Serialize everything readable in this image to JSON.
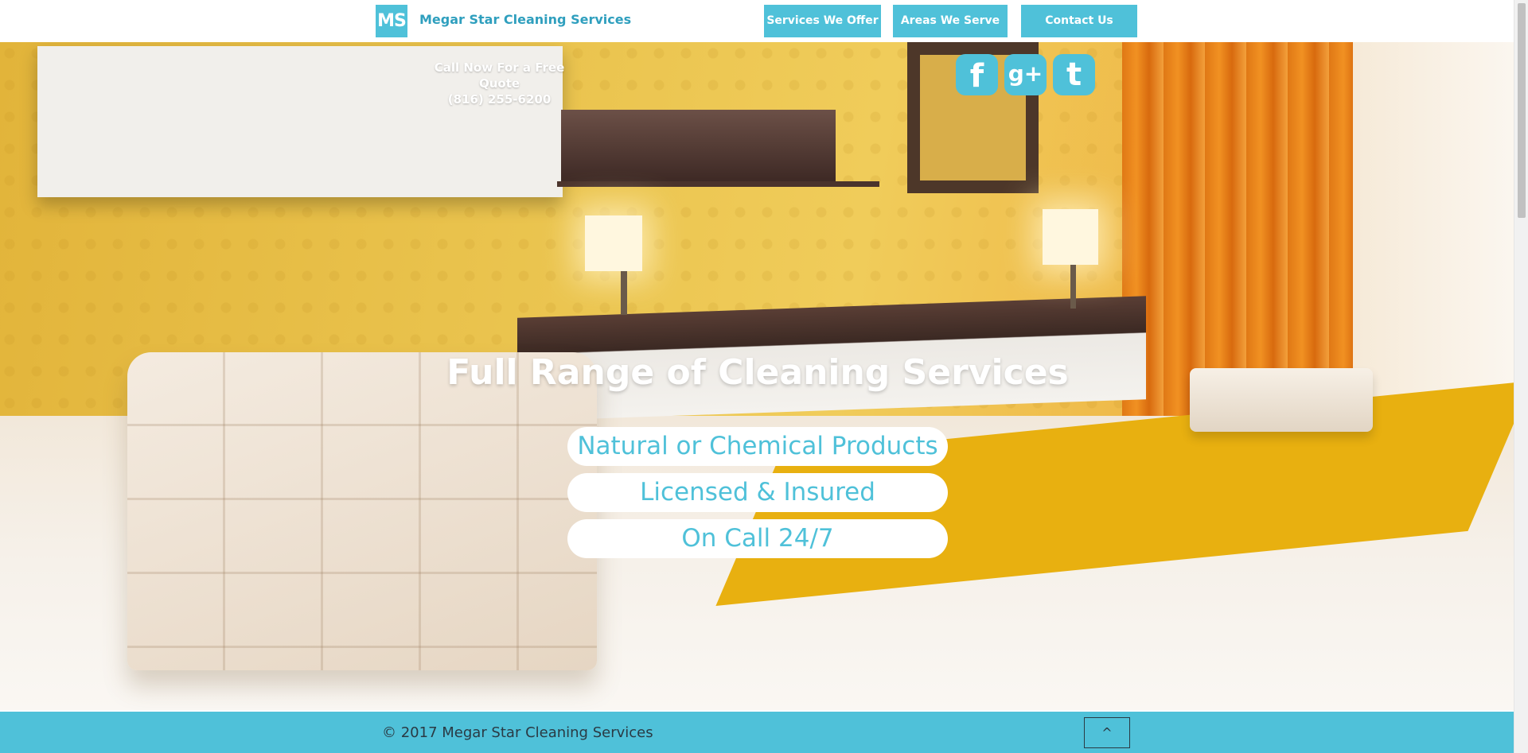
{
  "header": {
    "logo_text": "MS",
    "brand": "Megar Star Cleaning Services",
    "nav": [
      "Services We Offer",
      "Areas We Serve",
      "Contact Us"
    ]
  },
  "hero": {
    "quote_line1": "Call Now For a Free Quote",
    "quote_line2": "(816) 255-6200",
    "social": [
      {
        "icon": "facebook-icon",
        "glyph": "f"
      },
      {
        "icon": "google-plus-icon",
        "glyph": "g+"
      },
      {
        "icon": "twitter-icon",
        "glyph": "t"
      }
    ],
    "title": "Full Range of Cleaning Services",
    "features": [
      "Natural or Chemical Products",
      "Licensed & Insured",
      "On Call 24/7"
    ]
  },
  "footer": {
    "copyright": "© 2017 Megar Star Cleaning Services",
    "to_top_glyph": "^"
  },
  "colors": {
    "accent": "#4fc1d9",
    "brand_text": "#2f9fbe",
    "footer_text": "#2a3a44"
  }
}
